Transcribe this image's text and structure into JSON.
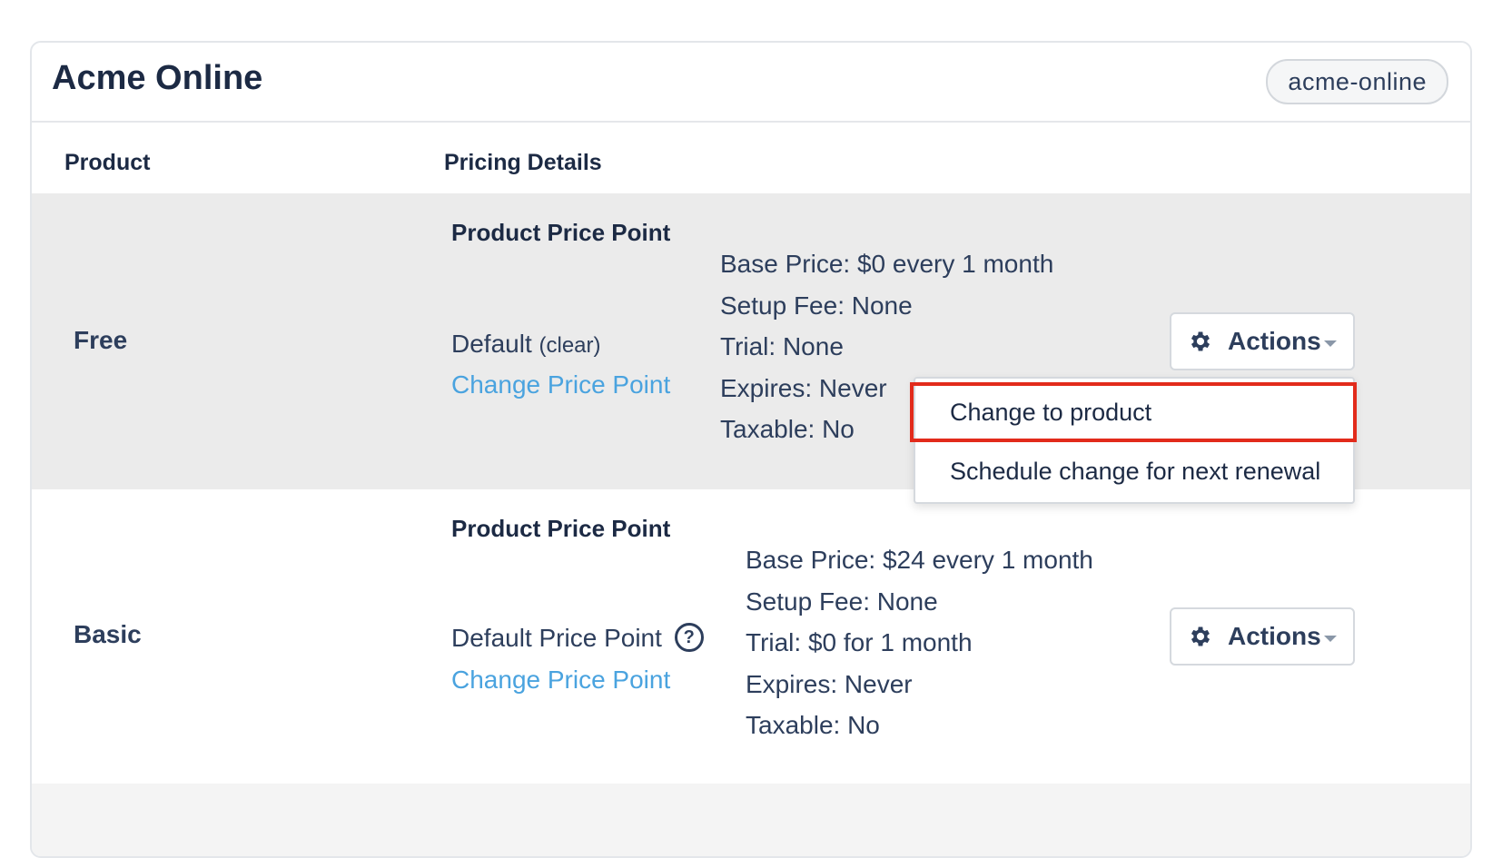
{
  "card": {
    "title": "Acme Online",
    "handle": "acme-online"
  },
  "columns": {
    "product": "Product",
    "pricing_details": "Pricing Details"
  },
  "rows": [
    {
      "product": "Free",
      "price_point_heading": "Product Price Point",
      "price_point_name": "Default",
      "price_point_clear": "(clear)",
      "change_link": "Change Price Point",
      "details": {
        "base_price": "Base Price: $0 every 1 month",
        "setup_fee": "Setup Fee: None",
        "trial": "Trial: None",
        "expires": "Expires: Never",
        "taxable": "Taxable: No"
      },
      "actions_label": "Actions"
    },
    {
      "product": "Basic",
      "price_point_heading": "Product Price Point",
      "price_point_name": "Default Price Point",
      "help_icon_glyph": "?",
      "change_link": "Change Price Point",
      "details": {
        "base_price": "Base Price: $24 every 1 month",
        "setup_fee": "Setup Fee: None",
        "trial": "Trial: $0 for 1 month",
        "expires": "Expires: Never",
        "taxable": "Taxable: No"
      },
      "actions_label": "Actions"
    }
  ],
  "dropdown": {
    "items": [
      {
        "label": "Change to product",
        "selected": true
      },
      {
        "label": "Schedule change for next renewal",
        "selected": false
      }
    ]
  },
  "colors": {
    "link": "#4aa3df",
    "text": "#2d3e5c",
    "highlight_row": "#ebebeb",
    "selection_outline": "#e22b1b"
  },
  "icons": {
    "actions": "gear-icon",
    "dropdown": "caret-down-icon",
    "help": "question-circle-icon"
  }
}
